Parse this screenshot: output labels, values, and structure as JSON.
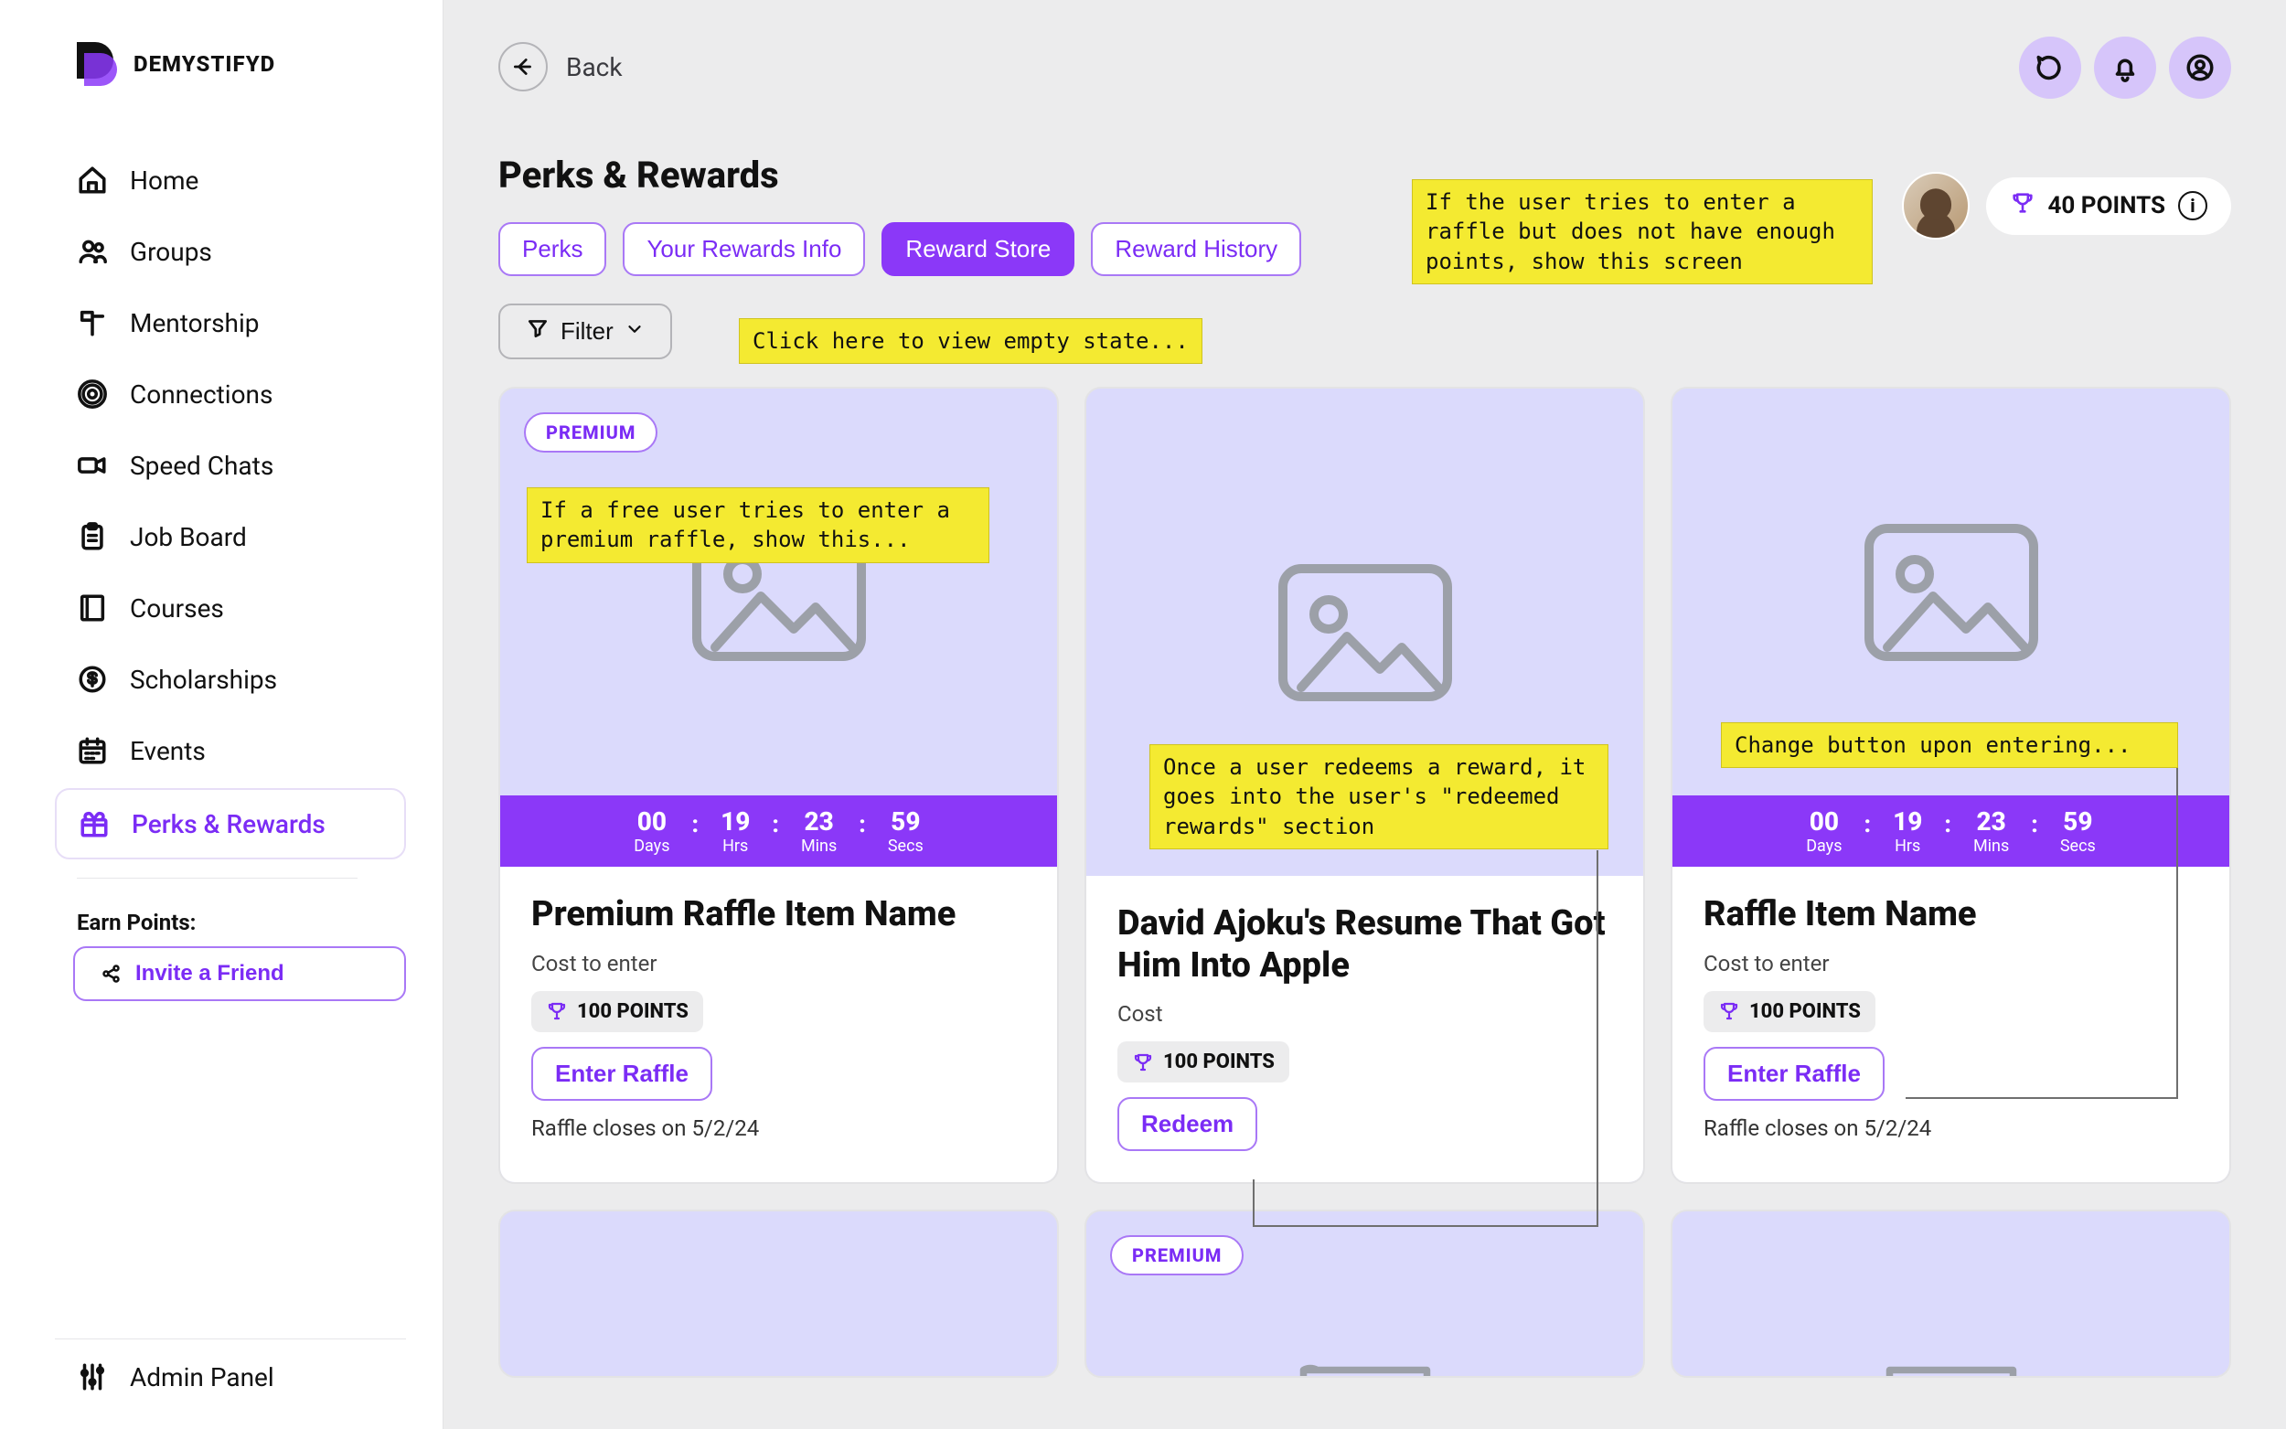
{
  "brand": {
    "name": "DEMYSTIFYD"
  },
  "sidebar": {
    "items": [
      {
        "label": "Home"
      },
      {
        "label": "Groups"
      },
      {
        "label": "Mentorship"
      },
      {
        "label": "Connections"
      },
      {
        "label": "Speed Chats"
      },
      {
        "label": "Job Board"
      },
      {
        "label": "Courses"
      },
      {
        "label": "Scholarships"
      },
      {
        "label": "Events"
      },
      {
        "label": "Perks & Rewards"
      }
    ],
    "earn_label": "Earn Points:",
    "invite_label": "Invite a Friend",
    "admin_label": "Admin Panel"
  },
  "header": {
    "back_label": "Back",
    "page_title": "Perks & Rewards",
    "tabs": [
      {
        "label": "Perks"
      },
      {
        "label": "Your Rewards Info"
      },
      {
        "label": "Reward Store"
      },
      {
        "label": "Reward History"
      }
    ],
    "filter_label": "Filter",
    "points_value": "40 POINTS"
  },
  "annotations": {
    "insufficient_points": "If the user tries to enter a raffle but does not have enough points, show this screen",
    "empty_state": "Click here to view empty state...",
    "premium_free_user": "If a free user tries to enter a premium raffle, show this...",
    "redeemed_flow": "Once a user redeems a reward, it goes into the user's \"redeemed rewards\" section",
    "change_button": "Change button upon entering..."
  },
  "countdown": {
    "days": "00",
    "days_lbl": "Days",
    "hrs": "19",
    "hrs_lbl": "Hrs",
    "mins": "23",
    "mins_lbl": "Mins",
    "secs": "59",
    "secs_lbl": "Secs"
  },
  "cards": [
    {
      "premium_tag": "PREMIUM",
      "title": "Premium Raffle Item Name",
      "cost_label": "Cost to enter",
      "points": "100 POINTS",
      "button": "Enter Raffle",
      "closes": "Raffle closes on 5/2/24"
    },
    {
      "title": "David Ajoku's Resume That Got Him Into Apple",
      "cost_label": "Cost",
      "points": "100 POINTS",
      "button": "Redeem"
    },
    {
      "title": "Raffle Item Name",
      "cost_label": "Cost to enter",
      "points": "100 POINTS",
      "button": "Enter Raffle",
      "closes": "Raffle closes on 5/2/24"
    }
  ],
  "row2_premium": "PREMIUM"
}
